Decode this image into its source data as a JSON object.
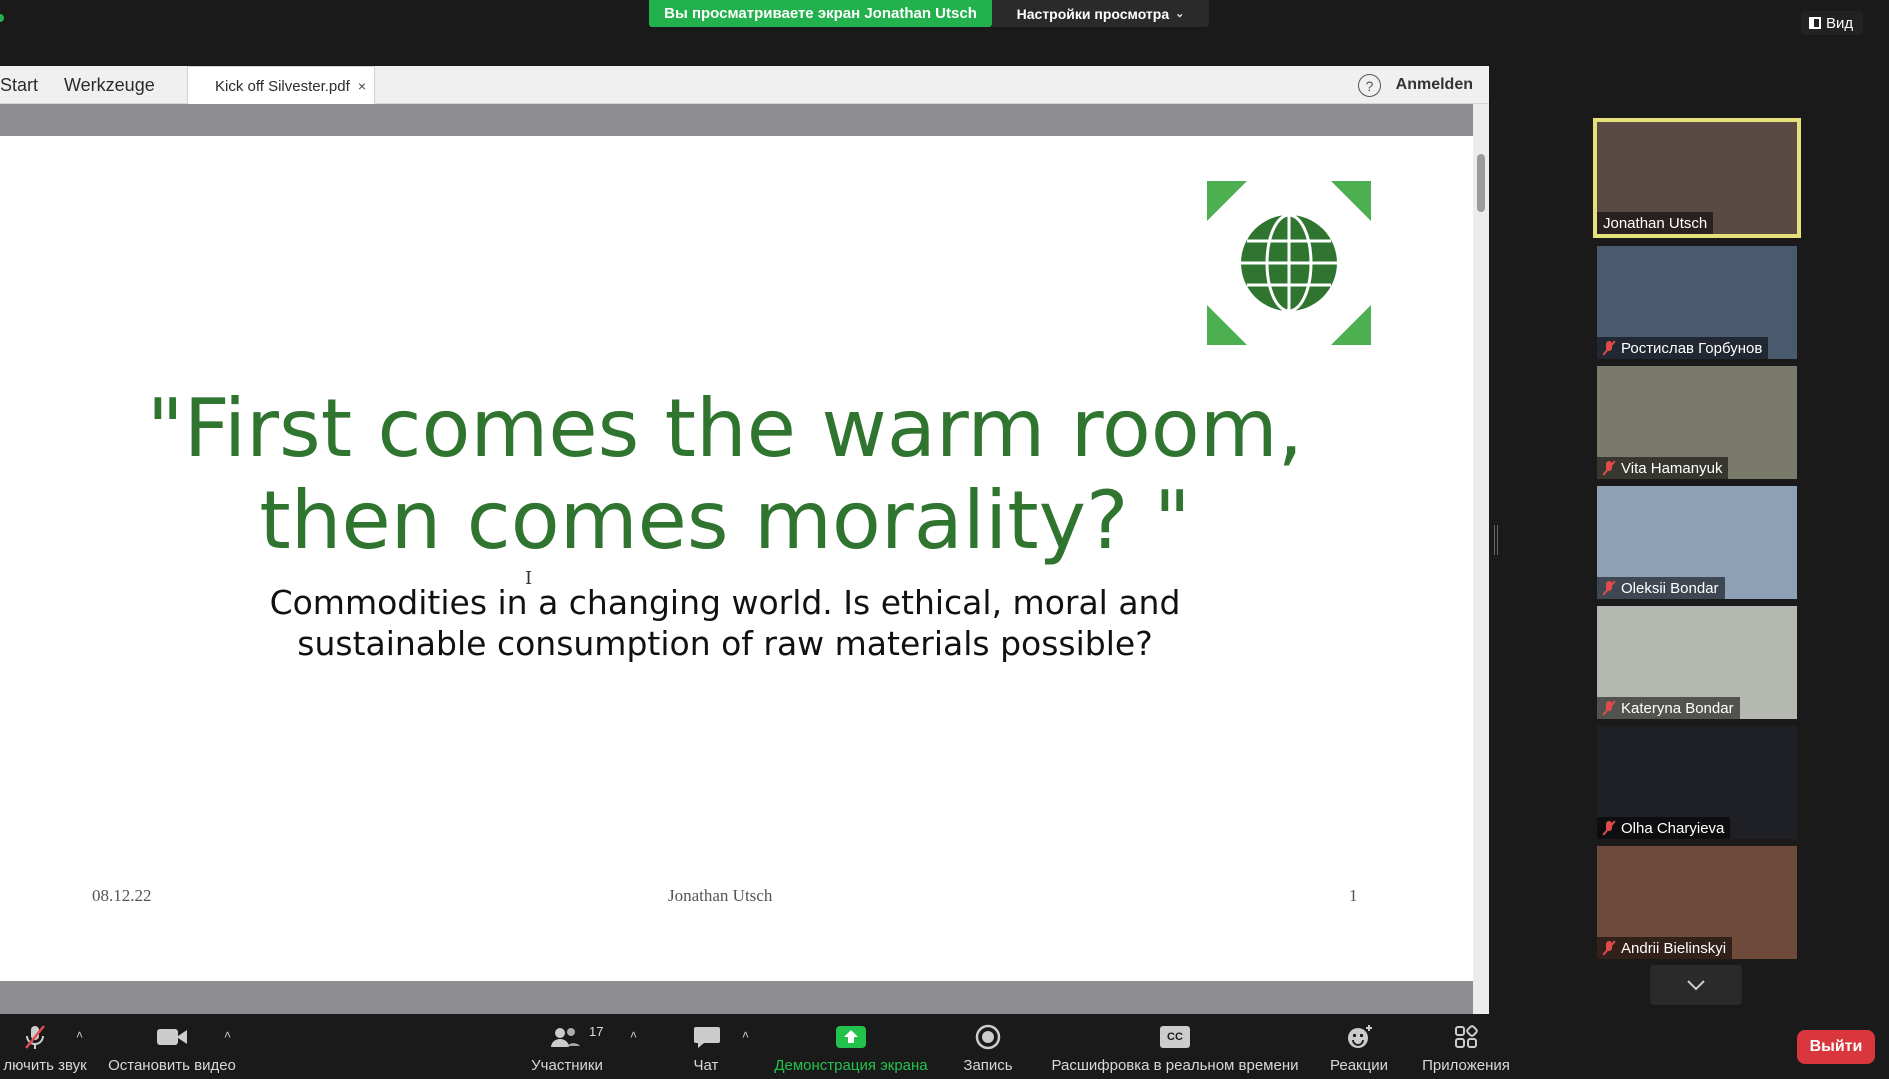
{
  "banner": {
    "share_text": "Вы просматриваете экран Jonathan Utsch",
    "view_settings": "Настройки просмотра"
  },
  "view_button": {
    "label": "Вид"
  },
  "acrobat": {
    "tab_start": "Start",
    "tab_tools": "Werkzeuge",
    "tab_file": "Kick off Silvester.pdf",
    "close_glyph": "×",
    "help_glyph": "?",
    "sign_in": "Anmelden"
  },
  "slide": {
    "title_line1": "\"First comes the warm room,",
    "title_line2": "then comes morality? \"",
    "subtitle_line1": "Commodities in a changing world. Is ethical, moral and",
    "subtitle_line2": "sustainable consumption of raw materials possible?",
    "footer_date": "08.12.22",
    "footer_author": "Jonathan Utsch",
    "footer_page": "1",
    "logo_color": "#2f7530",
    "accent_color": "#4caf50"
  },
  "participants": [
    {
      "name": "Jonathan Utsch",
      "muted": false,
      "active": true,
      "bg": "#5a4a45"
    },
    {
      "name": "Ростислав Горбунов",
      "muted": true,
      "active": false,
      "bg": "#4a5a6e"
    },
    {
      "name": "Vita Hamanyuk",
      "muted": true,
      "active": false,
      "bg": "#7a7a6a"
    },
    {
      "name": "Oleksii Bondar",
      "muted": true,
      "active": false,
      "bg": "#8da0b5"
    },
    {
      "name": "Kateryna Bondar",
      "muted": true,
      "active": false,
      "bg": "#b5b8b0"
    },
    {
      "name": "Olha Charyieva",
      "muted": true,
      "active": false,
      "bg": "#1f1f26"
    },
    {
      "name": "Andrii Bielinskyi",
      "muted": true,
      "active": false,
      "bg": "#6e4a3a"
    }
  ],
  "toolbar": {
    "mute_label": "лючить звук",
    "video_label": "Остановить видео",
    "participants_label": "Участники",
    "participants_count": "17",
    "chat_label": "Чат",
    "share_label": "Демонстрация экрана",
    "record_label": "Запись",
    "transcript_label": "Расшифровка в реальном времени",
    "cc_text": "CC",
    "reactions_label": "Реакции",
    "apps_label": "Приложения",
    "exit_label": "Выйти"
  },
  "icons": {
    "caret": "˄",
    "dropdown": "˅"
  }
}
